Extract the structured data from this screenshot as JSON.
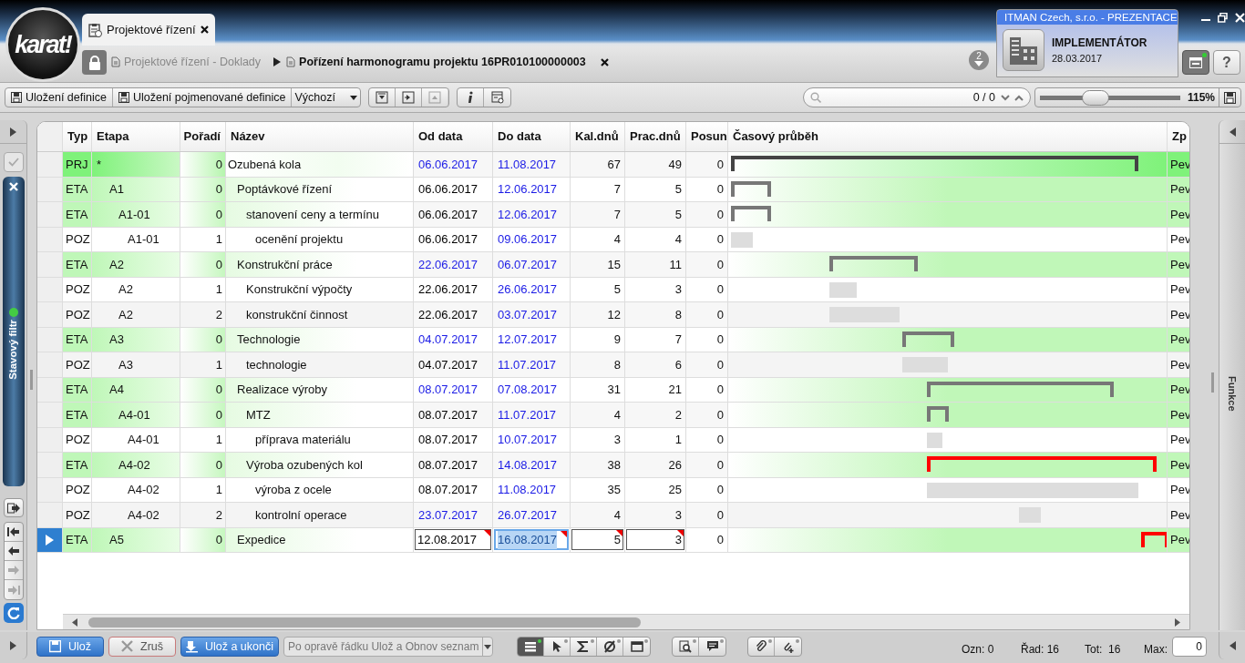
{
  "logo": {
    "text": "karat!"
  },
  "tab": {
    "label": "Projektové řízení",
    "selected": true
  },
  "breadcrumb": [
    {
      "label": "Projektové řízení - Doklady",
      "current": false
    },
    {
      "label": "Pořízení harmonogramu projektu 16PR010100000003",
      "current": true
    }
  ],
  "notifications": {
    "count": "2"
  },
  "help": {
    "label": "?"
  },
  "company": {
    "name": "ITMAN Czech, s.r.o. - PREZENTACE",
    "role": "IMPLEMENTÁTOR",
    "date": "28.03.2017"
  },
  "toolbar": {
    "buttons": [
      "Uložení definice",
      "Uložení pojmenované definice"
    ],
    "definition": "Výchozí",
    "tools": [
      {
        "kind": "collapse",
        "disabled": false
      },
      {
        "kind": "expand",
        "disabled": false
      },
      {
        "kind": "up",
        "disabled": true
      }
    ],
    "search_count": "0 / 0",
    "zoom": {
      "level": 0.37,
      "reading": "115%"
    }
  },
  "left_panel": {
    "filter_label": "Stavový filtr",
    "filter_active": true
  },
  "right_panel": {
    "label": "Funkce"
  },
  "table": {
    "columns": [
      "Typ",
      "Etapa",
      "Pořadí",
      "Název",
      "Od data",
      "Do data",
      "Kal.dnů",
      "Prac.dnů",
      "Posun",
      "Časový průběh",
      "Zp"
    ],
    "rows": [
      {
        "kind": "project",
        "type": "PRJ",
        "stage": "*",
        "order": "0",
        "name": "Ozubená kola",
        "start": {
          "value": "06.06.2017",
          "highlighted": true
        },
        "end": {
          "value": "11.08.2017",
          "highlighted": true
        },
        "calendar_days": "67",
        "work_days": "49",
        "shift": "0",
        "method": "Pev",
        "selected": false,
        "overdue": false,
        "children": [
          {
            "kind": "stage",
            "type": "ETA",
            "stage": "A1",
            "order": "0",
            "name": "Poptávkové řízení",
            "start": {
              "value": "06.06.2017",
              "highlighted": false
            },
            "end": {
              "value": "12.06.2017",
              "highlighted": true
            },
            "calendar_days": "7",
            "work_days": "5",
            "shift": "0",
            "method": "Pev",
            "selected": false,
            "overdue": false,
            "children": [
              {
                "kind": "stage",
                "type": "ETA",
                "stage": "A1-01",
                "order": "0",
                "name": "stanovení ceny a termínu",
                "start": {
                  "value": "06.06.2017",
                  "highlighted": false
                },
                "end": {
                  "value": "12.06.2017",
                  "highlighted": true
                },
                "calendar_days": "7",
                "work_days": "5",
                "shift": "0",
                "method": "Pev",
                "selected": false,
                "overdue": false,
                "children": [
                  {
                    "kind": "item",
                    "type": "POZ",
                    "stage": "A1-01",
                    "order": "1",
                    "name": "ocenění projektu",
                    "start": {
                      "value": "06.06.2017",
                      "highlighted": false
                    },
                    "end": {
                      "value": "09.06.2017",
                      "highlighted": true
                    },
                    "calendar_days": "4",
                    "work_days": "4",
                    "shift": "0",
                    "method": "Pev",
                    "selected": false,
                    "overdue": false
                  }
                ]
              }
            ]
          },
          {
            "kind": "stage",
            "type": "ETA",
            "stage": "A2",
            "order": "0",
            "name": "Konstrukční práce",
            "start": {
              "value": "22.06.2017",
              "highlighted": true
            },
            "end": {
              "value": "06.07.2017",
              "highlighted": true
            },
            "calendar_days": "15",
            "work_days": "11",
            "shift": "0",
            "method": "Pev",
            "selected": false,
            "overdue": false,
            "children": [
              {
                "kind": "item",
                "type": "POZ",
                "stage": "A2",
                "order": "1",
                "name": "Konstrukční výpočty",
                "start": {
                  "value": "22.06.2017",
                  "highlighted": false
                },
                "end": {
                  "value": "26.06.2017",
                  "highlighted": true
                },
                "calendar_days": "5",
                "work_days": "3",
                "shift": "0",
                "method": "Pev",
                "selected": false,
                "overdue": false
              },
              {
                "kind": "item",
                "type": "POZ",
                "stage": "A2",
                "order": "2",
                "name": "konstrukční činnost",
                "start": {
                  "value": "22.06.2017",
                  "highlighted": false
                },
                "end": {
                  "value": "03.07.2017",
                  "highlighted": true
                },
                "calendar_days": "12",
                "work_days": "8",
                "shift": "0",
                "method": "Pev",
                "selected": false,
                "overdue": false
              }
            ]
          },
          {
            "kind": "stage",
            "type": "ETA",
            "stage": "A3",
            "order": "0",
            "name": "Technologie",
            "start": {
              "value": "04.07.2017",
              "highlighted": true
            },
            "end": {
              "value": "12.07.2017",
              "highlighted": true
            },
            "calendar_days": "9",
            "work_days": "7",
            "shift": "0",
            "method": "Pev",
            "selected": false,
            "overdue": false,
            "children": [
              {
                "kind": "item",
                "type": "POZ",
                "stage": "A3",
                "order": "1",
                "name": "technologie",
                "start": {
                  "value": "04.07.2017",
                  "highlighted": false
                },
                "end": {
                  "value": "11.07.2017",
                  "highlighted": true
                },
                "calendar_days": "8",
                "work_days": "6",
                "shift": "0",
                "method": "Pev",
                "selected": false,
                "overdue": false
              }
            ]
          },
          {
            "kind": "stage",
            "type": "ETA",
            "stage": "A4",
            "order": "0",
            "name": "Realizace výroby",
            "start": {
              "value": "08.07.2017",
              "highlighted": true
            },
            "end": {
              "value": "07.08.2017",
              "highlighted": true
            },
            "calendar_days": "31",
            "work_days": "21",
            "shift": "0",
            "method": "Pev",
            "selected": false,
            "overdue": false,
            "children": [
              {
                "kind": "stage",
                "type": "ETA",
                "stage": "A4-01",
                "order": "0",
                "name": "MTZ",
                "start": {
                  "value": "08.07.2017",
                  "highlighted": false
                },
                "end": {
                  "value": "11.07.2017",
                  "highlighted": true
                },
                "calendar_days": "4",
                "work_days": "2",
                "shift": "0",
                "method": "Pev",
                "selected": false,
                "overdue": false,
                "children": [
                  {
                    "kind": "item",
                    "type": "POZ",
                    "stage": "A4-01",
                    "order": "1",
                    "name": "příprava materiálu",
                    "start": {
                      "value": "08.07.2017",
                      "highlighted": false
                    },
                    "end": {
                      "value": "10.07.2017",
                      "highlighted": true
                    },
                    "calendar_days": "3",
                    "work_days": "1",
                    "shift": "0",
                    "method": "Pev",
                    "selected": false,
                    "overdue": false
                  }
                ]
              },
              {
                "kind": "stage",
                "type": "ETA",
                "stage": "A4-02",
                "order": "0",
                "name": "Výroba ozubených kol",
                "start": {
                  "value": "08.07.2017",
                  "highlighted": false
                },
                "end": {
                  "value": "14.08.2017",
                  "highlighted": true
                },
                "calendar_days": "38",
                "work_days": "26",
                "shift": "0",
                "method": "Pev",
                "selected": false,
                "overdue": true,
                "children": [
                  {
                    "kind": "item",
                    "type": "POZ",
                    "stage": "A4-02",
                    "order": "1",
                    "name": "výroba z ocele",
                    "start": {
                      "value": "08.07.2017",
                      "highlighted": false
                    },
                    "end": {
                      "value": "11.08.2017",
                      "highlighted": true
                    },
                    "calendar_days": "35",
                    "work_days": "25",
                    "shift": "0",
                    "method": "Pev",
                    "selected": false,
                    "overdue": false
                  },
                  {
                    "kind": "item",
                    "type": "POZ",
                    "stage": "A4-02",
                    "order": "2",
                    "name": "kontrolní operace",
                    "start": {
                      "value": "23.07.2017",
                      "highlighted": true
                    },
                    "end": {
                      "value": "26.07.2017",
                      "highlighted": true
                    },
                    "calendar_days": "4",
                    "work_days": "3",
                    "shift": "0",
                    "method": "Pev",
                    "selected": false,
                    "overdue": false
                  }
                ]
              }
            ]
          },
          {
            "kind": "stage",
            "type": "ETA",
            "stage": "A5",
            "order": "0",
            "name": "Expedice",
            "start": {
              "value": "12.08.2017",
              "highlighted": false,
              "focused": false
            },
            "end": {
              "value": "16.08.2017",
              "highlighted": true,
              "focused": true
            },
            "calendar_days": "5",
            "work_days": "3",
            "shift": "0",
            "method": "Pev",
            "selected": true,
            "overdue": true
          }
        ]
      }
    ]
  },
  "bottom": {
    "buttons": [
      {
        "kind": "save",
        "label": "Ulož"
      },
      {
        "kind": "cancel",
        "label": "Zruš"
      },
      {
        "kind": "save_close",
        "label": "Ulož a ukonči"
      }
    ],
    "mode": "Po opravě řádku Ulož a Obnov seznam",
    "status": [
      "Ozn: 0",
      "Řad: 16",
      "Tot:  16"
    ],
    "max": {
      "label": "Max:",
      "value": "0"
    }
  }
}
